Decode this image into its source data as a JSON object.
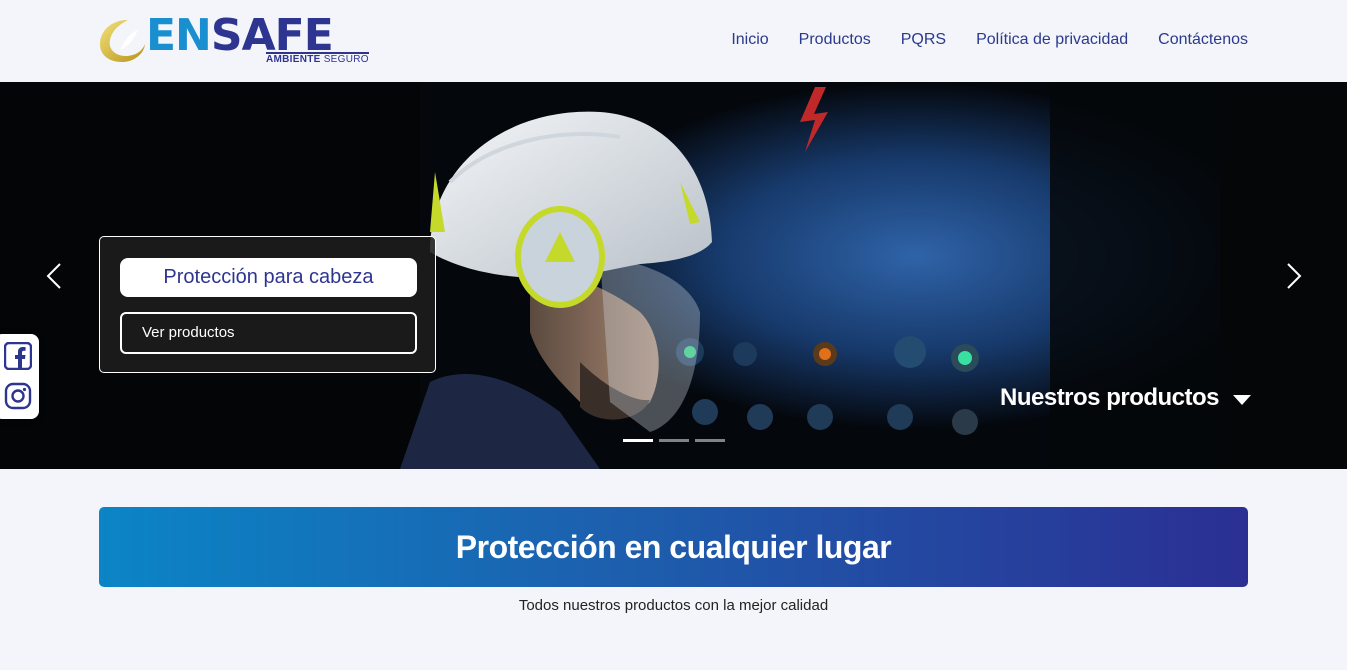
{
  "brand": {
    "name_part1": "EN",
    "name_part2": "SAFE",
    "tagline_bold": "AMBIENTE",
    "tagline_light": " SEGURO",
    "colors": {
      "blue": "#1a8fd0",
      "navy": "#2e3590",
      "gold": "#d8b420"
    }
  },
  "nav": {
    "items": [
      "Inicio",
      "Productos",
      "PQRS",
      "Política de privacidad",
      "Contáctenos"
    ]
  },
  "hero": {
    "caption_title": "Protección para cabeza",
    "caption_button": "Ver productos",
    "our_products": "Nuestros productos",
    "slides": {
      "count": 3,
      "active": 1
    }
  },
  "social": {
    "icons": [
      "facebook-icon",
      "instagram-icon"
    ]
  },
  "banner": {
    "title": "Protección en cualquier lugar",
    "subtitle": "Todos nuestros productos con la mejor calidad"
  }
}
